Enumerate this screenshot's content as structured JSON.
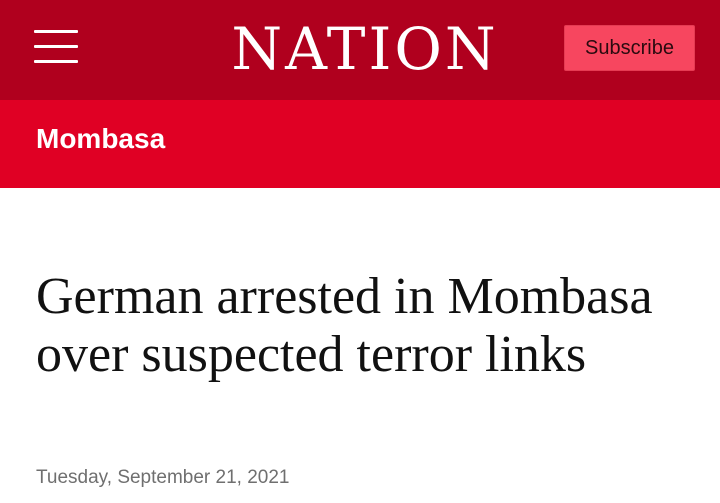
{
  "header": {
    "menu_icon": "hamburger-menu-icon",
    "logo_text": "NATION",
    "subscribe_label": "Subscribe",
    "colors": {
      "topbar": "#b0001e",
      "subscribe_button": "#f7465f"
    }
  },
  "section": {
    "label": "Mombasa",
    "color": "#e00024"
  },
  "article": {
    "headline": "German arrested in Mombasa over suspected terror links",
    "date": "Tuesday, September 21, 2021"
  }
}
